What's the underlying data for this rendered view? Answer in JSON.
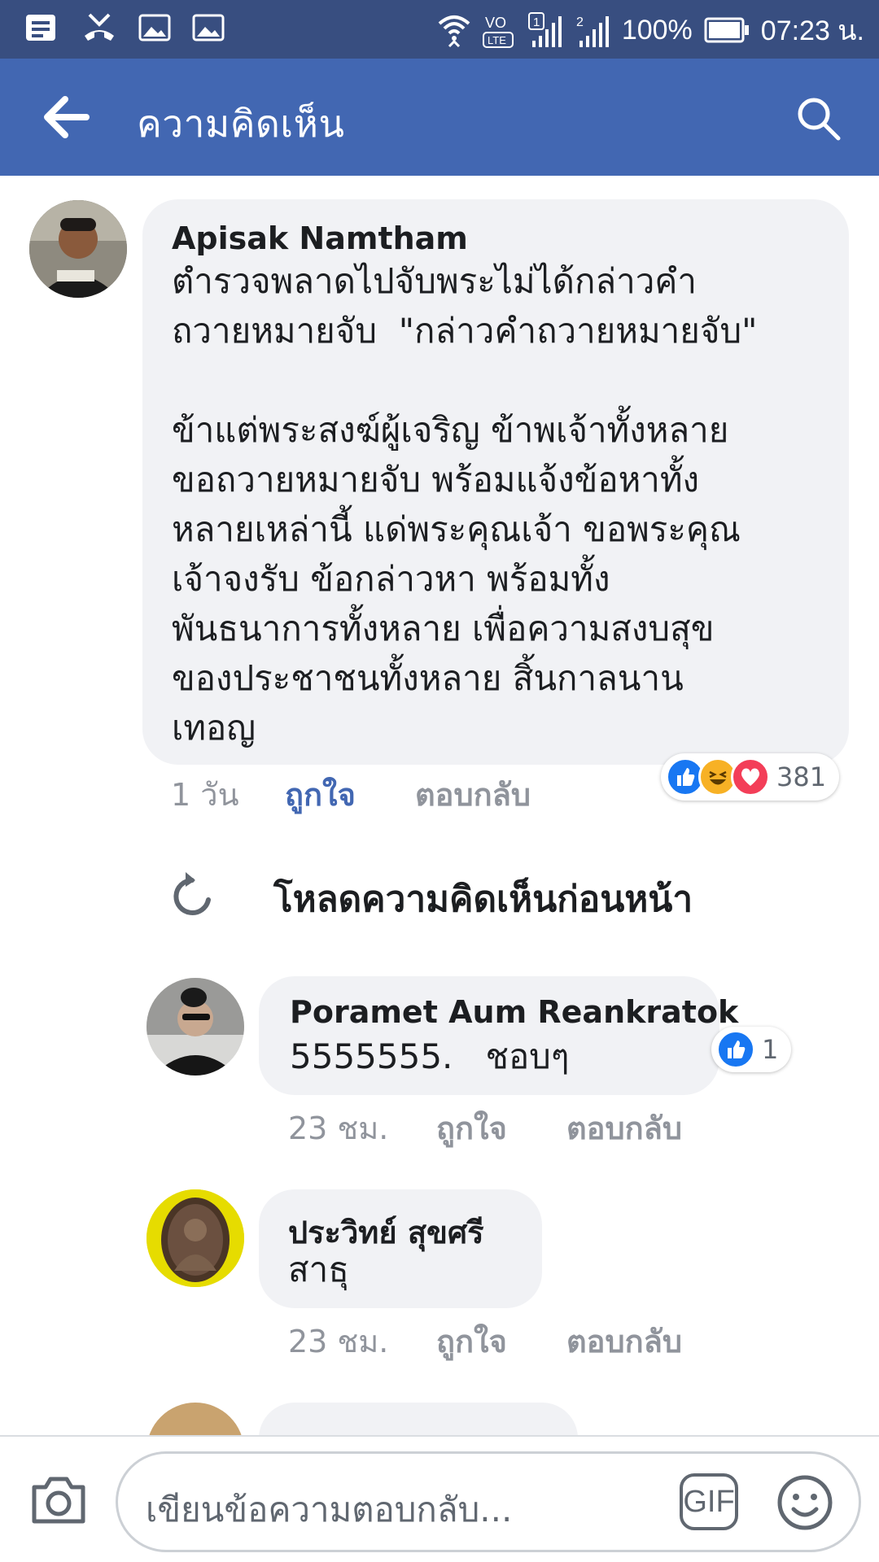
{
  "status_bar": {
    "battery": "100%",
    "time": "07:23 น.",
    "sim1": "1",
    "sim2": "2",
    "network": "LTE"
  },
  "header": {
    "title": "ความคิดเห็น",
    "back_icon": "back-arrow-icon",
    "search_icon": "search-icon"
  },
  "main_comment": {
    "author": "Apisak Namtham",
    "text": "ตำรวจพลาดไปจับพระไม่ได้กล่าวคำ\nถวายหมายจับ  \"กล่าวคำถวายหมายจับ\"\n\nข้าแต่พระสงฆ์ผู้เจริญ ข้าพเจ้าทั้งหลาย\nขอถวายหมายจับ พร้อมแจ้งข้อหาทั้ง\nหลายเหล่านี้ แด่พระคุณเจ้า ขอพระคุณ\nเจ้าจงรับ ข้อกล่าวหา พร้อมทั้ง\nพันธนาการทั้งหลาย เพื่อความสงบสุข\nของประชาชนทั้งหลาย สิ้นกาลนาน\nเทอญ",
    "time": "1 วัน",
    "like_label": "ถูกใจ",
    "reply_label": "ตอบกลับ",
    "reaction_count": "381",
    "liked": true
  },
  "load_previous": "โหลดความคิดเห็นก่อนหน้า",
  "replies": [
    {
      "author": "Poramet Aum Reankratok",
      "text": "5555555.   ชอบๆ",
      "time": "23 ชม.",
      "like_label": "ถูกใจ",
      "reply_label": "ตอบกลับ",
      "reaction_count": "1"
    },
    {
      "author": "ประวิทย์ สุขศรี",
      "text": "สาธุ",
      "time": "23 ชม.",
      "like_label": "ถูกใจ",
      "reply_label": "ตอบกลับ"
    }
  ],
  "composer": {
    "placeholder": "เขียนข้อความตอบกลับ...",
    "gif_label": "GIF"
  },
  "colors": {
    "status_bar": "#384e80",
    "app_bar": "#4267b2",
    "liked_blue": "#4267b2",
    "bubble": "#f1f2f5",
    "love_red": "#f33e58",
    "haha_yellow": "#f7b125",
    "like_blue": "#1877f2"
  }
}
